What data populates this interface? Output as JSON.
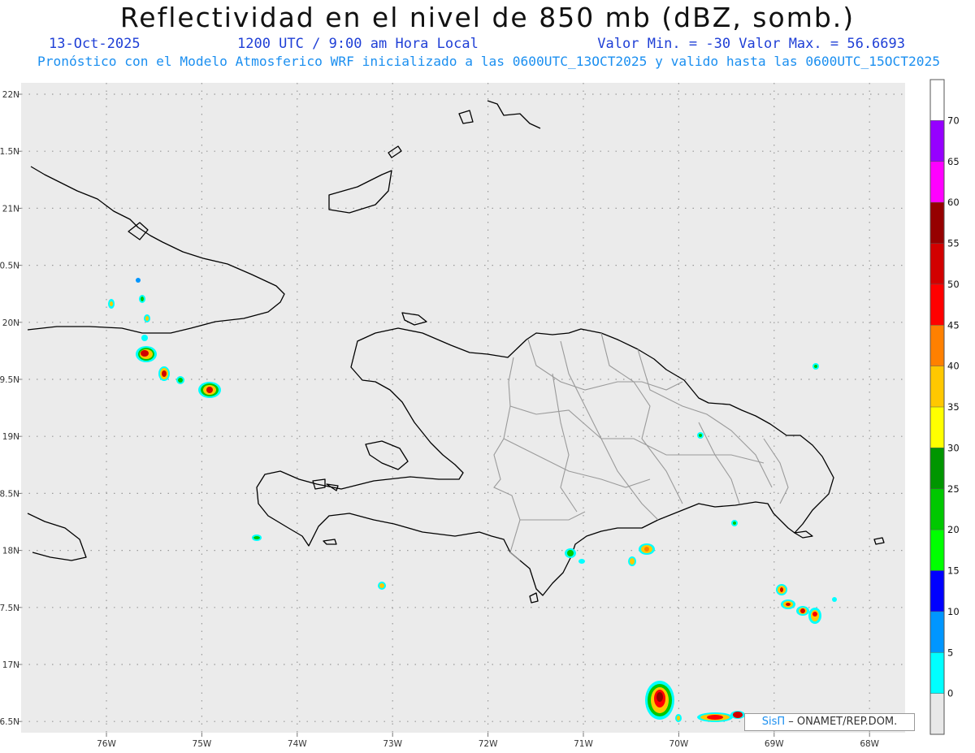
{
  "header": {
    "title": "Reflectividad en el nivel de 850 mb (dBZ, somb.)",
    "date": "13-Oct-2025",
    "time": "1200 UTC / 9:00 am Hora Local",
    "minmax": "Valor Min. = -30  Valor Max. = 56.6693",
    "subtitle": "Pronóstico con el Modelo Atmosferico WRF inicializado a las 0600UTC_13OCT2025 y valido hasta las  0600UTC_15OCT2025"
  },
  "map": {
    "lon_range": [
      -76.7,
      -67.6
    ],
    "lat_range": [
      16.45,
      22.1
    ],
    "lon_labels": [
      "76W",
      "75W",
      "74W",
      "73W",
      "72W",
      "71W",
      "70W",
      "69W",
      "68W"
    ],
    "lat_labels": [
      "22N",
      "1.5N",
      "21N",
      "0.5N",
      "20N",
      "9.5N",
      "19N",
      "8.5N",
      "18N",
      "7.5N",
      "17N",
      "6.5N"
    ],
    "background": "#ebebeb",
    "coast_color": "#000000",
    "province_color": "#9a9a9a"
  },
  "colorbar": {
    "labels": [
      "0",
      "5",
      "10",
      "15",
      "20",
      "25",
      "30",
      "35",
      "40",
      "45",
      "50",
      "55",
      "60",
      "65",
      "70"
    ],
    "colors": [
      "#e8e8e8",
      "#00ffff",
      "#0096ff",
      "#0000ff",
      "#00ff00",
      "#00c800",
      "#009600",
      "#ffff00",
      "#ffc800",
      "#ff8000",
      "#ff0000",
      "#d20000",
      "#960000",
      "#ff00ff",
      "#9600ff",
      "#ffffff"
    ]
  },
  "credit": {
    "brand": "SisΠ",
    "text": " – ONAMET/REP.DOM."
  }
}
